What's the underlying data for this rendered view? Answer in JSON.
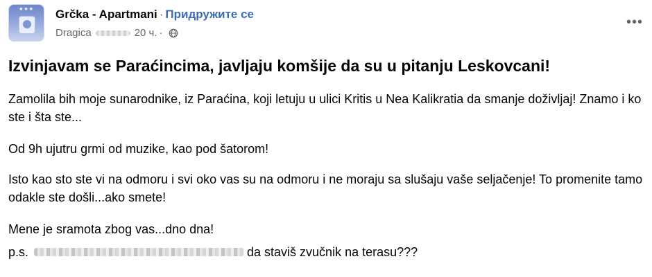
{
  "header": {
    "group_name": "Grčka - Apartmani",
    "separator": "·",
    "join_label": "Придружите се",
    "author": "Dragica",
    "time": "20 ч.",
    "dot": "·",
    "privacy_icon": "globe-icon",
    "more_icon": "more-options-icon",
    "avatar_stars": "★★★"
  },
  "post": {
    "title": "Izvinjavam se Paraćincima, javljaju komšije da su u pitanju Leskovcani!",
    "paragraphs": [
      "Zamolila bih moje sunarodnike, iz Paraćina, koji letuju u ulici Kritis u Nea Kalikratia da smanje doživljaj! Znamo i ko ste i šta ste...",
      "Od 9h ujutru grmi od muzike, kao pod šatorom!",
      "Isto kao sto ste vi na odmoru i svi oko vas su na odmoru i ne moraju sa slušaju vaše seljačenje! To promenite tamo odakle ste došli...ako smete!",
      "Mene je sramota zbog vas...dno dna!"
    ],
    "ps_prefix": "p.s.",
    "ps_suffix": "da staviš zvučnik na terasu???"
  },
  "colors": {
    "text": "#050505",
    "meta": "#65676b",
    "link": "#3b6bb5",
    "background": "#ffffff"
  }
}
